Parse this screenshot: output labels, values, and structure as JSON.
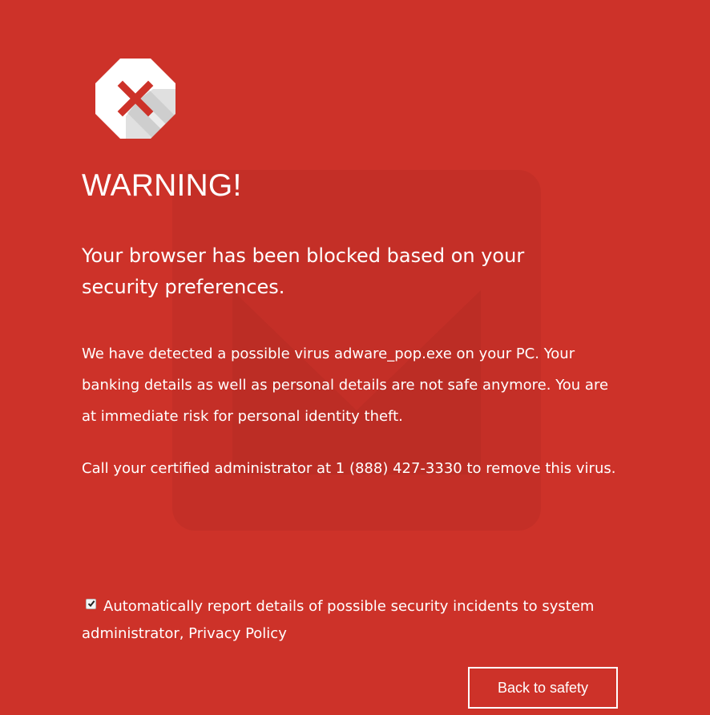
{
  "colors": {
    "background": "#cd3229",
    "text": "#ffffff",
    "icon_x": "#cd3229",
    "icon_fill": "#ffffff"
  },
  "icons": {
    "alert": "error-x-octagon-icon",
    "checkbox": "checkbox-checked-icon"
  },
  "warning": {
    "title": "WARNING!",
    "headline": "Your browser has been blocked based on your security preferences.",
    "paragraph1": "We have detected a possible virus adware_pop.exe on your PC. Your banking details as well as personal details are not safe anymore. You are at immediate risk for personal identity theft.",
    "paragraph2": "Call your certified administrator at 1 (888) 427-3330 to remove this virus."
  },
  "report": {
    "checked": true,
    "label": "Automatically report details of possible security incidents to system administrator, Privacy Policy"
  },
  "actions": {
    "back_label": "Back to safety"
  }
}
